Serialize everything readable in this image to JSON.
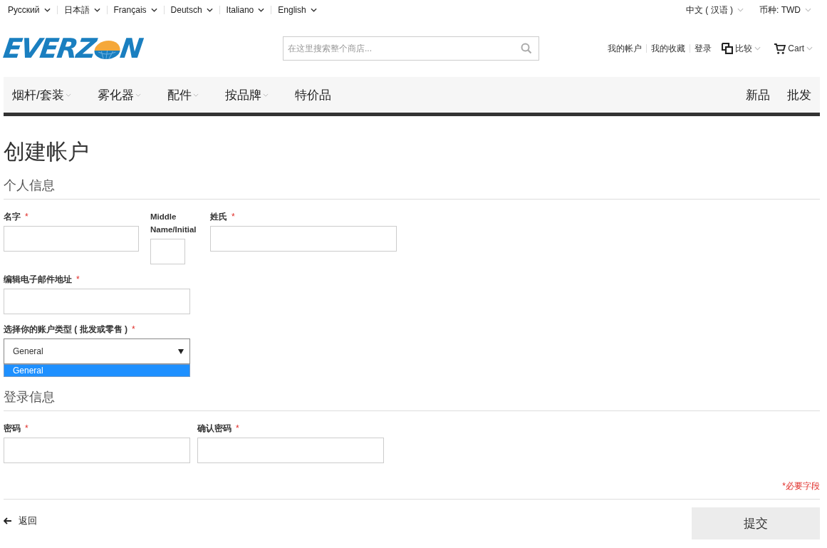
{
  "languages": [
    {
      "label": "Русский"
    },
    {
      "label": "日本語"
    },
    {
      "label": "Français"
    },
    {
      "label": "Deutsch"
    },
    {
      "label": "Italiano"
    },
    {
      "label": "English"
    }
  ],
  "store_switcher": {
    "language": "中文 ( 汉语 )",
    "currency": "币种:  TWD"
  },
  "logo": {
    "before": "EVERZ",
    "after": "N"
  },
  "search": {
    "placeholder": "在这里搜索整个商店..."
  },
  "header_links": [
    "我的帐户",
    "我的收藏",
    "登录"
  ],
  "compare": "比较",
  "cart": "Cart",
  "nav": [
    {
      "label": "烟杆/套装",
      "has_dropdown": true
    },
    {
      "label": "雾化器",
      "has_dropdown": true
    },
    {
      "label": "配件",
      "has_dropdown": true
    },
    {
      "label": "按品牌",
      "has_dropdown": true
    },
    {
      "label": "特价品",
      "has_dropdown": false
    }
  ],
  "nav_right": [
    "新品",
    "批发"
  ],
  "title": "创建帐户",
  "personal_section": "个人信息",
  "first_name": {
    "label": "名字",
    "required_mark": "*"
  },
  "middle_name": {
    "label": "Middle Name/Initial"
  },
  "last_name": {
    "label": "姓氏",
    "required_mark": "*"
  },
  "email": {
    "label": "编辑电子邮件地址",
    "required_mark": "*"
  },
  "account_type": {
    "label": "选择你的账户类型 ( 批发或零售 )",
    "required_mark": "*",
    "value": "General",
    "expanded": true,
    "options": [
      {
        "label": "General",
        "selected": true
      }
    ]
  },
  "login_section": "登录信息",
  "password": {
    "label": "密码",
    "required_mark": "*"
  },
  "confirm_password": {
    "label": "确认密码",
    "required_mark": "*"
  },
  "required_note": "*必要字段",
  "back_link": "返回",
  "submit": "提交"
}
